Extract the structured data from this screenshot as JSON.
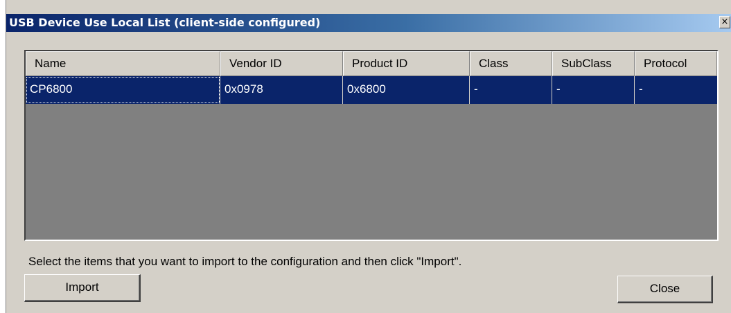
{
  "window": {
    "title": "USB Device Use Local List (client-side configured)",
    "close_glyph": "×"
  },
  "list": {
    "columns": [
      "Name",
      "Vendor ID",
      "Product ID",
      "Class",
      "SubClass",
      "Protocol"
    ],
    "rows": [
      {
        "selected": true,
        "cells": [
          "CP6800",
          "0x0978",
          "0x6800",
          "-",
          "-",
          "-"
        ]
      }
    ],
    "selection_color": "#0a246a",
    "background_color": "#808080"
  },
  "instructions": "Select the items that you want to import to the configuration and then click \"Import\".",
  "buttons": {
    "import_label": "Import",
    "close_label": "Close"
  },
  "colors": {
    "dialog_face": "#d4d0c8",
    "titlebar_start": "#0a246a",
    "titlebar_end": "#a6caf0"
  },
  "icons": {
    "close": "close-icon"
  }
}
